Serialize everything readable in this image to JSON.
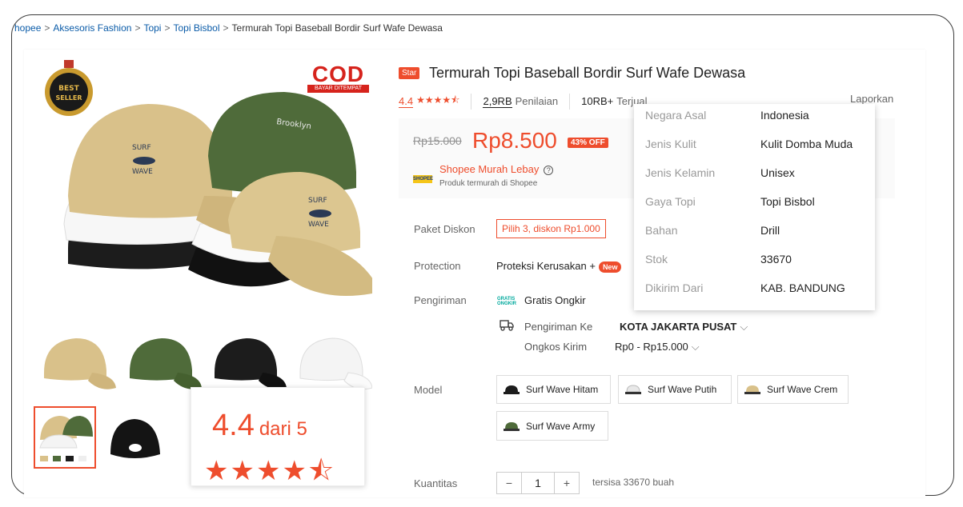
{
  "breadcrumb": {
    "items": [
      "hopee",
      "Aksesoris Fashion",
      "Topi",
      "Topi Bisbol"
    ],
    "current": "Termurah Topi Baseball Bordir Surf Wafe Dewasa",
    "separator": ">"
  },
  "gallery": {
    "badges": {
      "best_seller": "BEST SELLER",
      "cod_title": "COD",
      "cod_sub": "BAYAR DITEMPAT"
    },
    "cap_colors": [
      "#d9c18a",
      "#ffffff",
      "#1c1c1c",
      "#4f6b3a"
    ]
  },
  "rating_popup": {
    "score": "4.4",
    "dari": "dari 5",
    "stars": "★★★★⯪"
  },
  "product": {
    "badge": "Star",
    "title": "Termurah Topi Baseball Bordir Surf Wafe Dewasa",
    "rating": "4.4",
    "rating_stars": "★★★★⯪",
    "review_count": "2,9RB",
    "review_label": "Penilaian",
    "sold_count": "10RB+",
    "sold_label": "Terjual",
    "report": "Laporkan"
  },
  "price": {
    "old": "Rp15.000",
    "new": "Rp8.500",
    "discount": "43% OFF",
    "promo_logo": "SHOPEE",
    "promo_title": "Shopee Murah Lebay",
    "promo_help": "?",
    "promo_sub": "Produk termurah di Shopee"
  },
  "labels": {
    "paket": "Paket Diskon",
    "protection": "Protection",
    "pengiriman": "Pengiriman",
    "model": "Model",
    "kuantitas": "Kuantitas"
  },
  "paket_diskon": "Pilih 3, diskon Rp1.000",
  "protection": {
    "text": "Proteksi Kerusakan +",
    "badge": "New"
  },
  "shipping": {
    "gratis_logo": "GRATIS ONGKIR",
    "gratis": "Gratis Ongkir",
    "kirim_ke_label": "Pengiriman Ke",
    "kota": "KOTA JAKARTA PUSAT",
    "ongkos_label": "Ongkos Kirim",
    "ongkos": "Rp0 - Rp15.000"
  },
  "models": [
    {
      "label": "Surf Wave Hitam",
      "color": "#1c1c1c"
    },
    {
      "label": "Surf Wave Putih",
      "color": "#e8e8e8"
    },
    {
      "label": "Surf Wave Crem",
      "color": "#d9c18a"
    },
    {
      "label": "Surf Wave Army",
      "color": "#4f6b3a"
    }
  ],
  "quantity": {
    "minus": "−",
    "value": "1",
    "plus": "+",
    "stock": "tersisa 33670 buah"
  },
  "specs": [
    {
      "key": "Negara Asal",
      "value": "Indonesia"
    },
    {
      "key": "Jenis Kulit",
      "value": "Kulit Domba Muda"
    },
    {
      "key": "Jenis Kelamin",
      "value": "Unisex"
    },
    {
      "key": "Gaya Topi",
      "value": "Topi Bisbol"
    },
    {
      "key": "Bahan",
      "value": "Drill"
    },
    {
      "key": "Stok",
      "value": "33670"
    },
    {
      "key": "Dikirim Dari",
      "value": "KAB. BANDUNG"
    }
  ],
  "colors": {
    "accent": "#ee4d2d",
    "link": "#0a5ba8"
  }
}
